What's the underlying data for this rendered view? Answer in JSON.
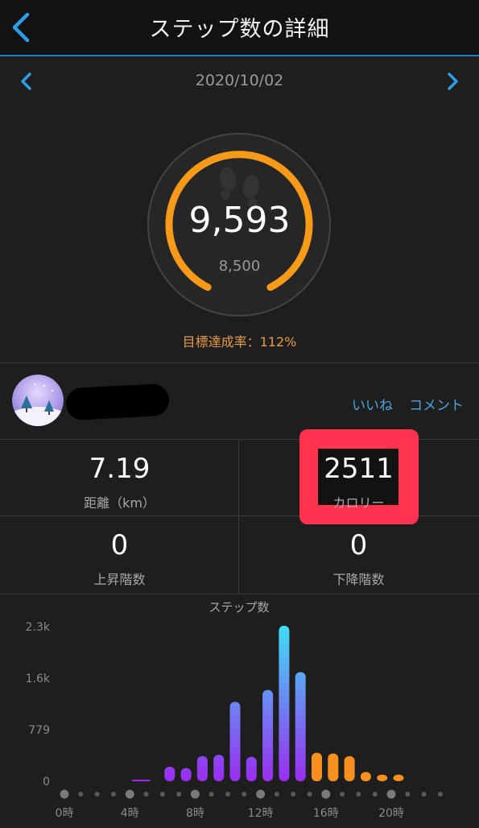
{
  "header": {
    "title": "ステップ数の詳細"
  },
  "date_nav": {
    "date": "2020/10/02"
  },
  "summary": {
    "steps": "9,593",
    "goal": "8,500",
    "achievement": "目標達成率：112%",
    "progress_fraction": 1.0
  },
  "social": {
    "like": "いいね",
    "comment": "コメント"
  },
  "stats": {
    "distance": {
      "value": "7.19",
      "label": "距離（km）"
    },
    "calories": {
      "value": "2511",
      "label": "カロリー"
    },
    "floors_up": {
      "value": "0",
      "label": "上昇階数"
    },
    "floors_down": {
      "value": "0",
      "label": "下降階数"
    }
  },
  "colors": {
    "ring": "#f79a1a",
    "accent_blue": "#2b9ee6",
    "link": "#4aa3df",
    "highlight": "#ff334f",
    "bar_low": "#9a2cf0",
    "bar_high": "#40dcf5",
    "bar_orange": "#f7901e"
  },
  "chart_data": {
    "type": "bar",
    "title": "ステップ数",
    "y_ticks": [
      "2.3k",
      "1.6k",
      "779",
      "0"
    ],
    "y_tick_values": [
      2337,
      1558,
      779,
      0
    ],
    "ylim": [
      0,
      2337
    ],
    "x_tick_labels": [
      "0時",
      "4時",
      "8時",
      "12時",
      "16時",
      "20時"
    ],
    "x_tick_hours": [
      0,
      4,
      8,
      12,
      16,
      20
    ],
    "hours": [
      4,
      4.5,
      6,
      6.5,
      7,
      7.5,
      8,
      8.5,
      9,
      9.5,
      10,
      10.5,
      11,
      11.5,
      12,
      12.5,
      13,
      13.5,
      14,
      14.5,
      15,
      15.5,
      16,
      16.5,
      17,
      17.5,
      18,
      18.5,
      19,
      19.5,
      20,
      20.5
    ],
    "values": [
      5,
      5,
      220,
      200,
      380,
      400,
      1200,
      370,
      1380,
      2350,
      1650,
      430,
      420,
      380,
      140,
      100,
      100
    ],
    "bar_hours": [
      4,
      4.5,
      6,
      7,
      8,
      9,
      10,
      11,
      12,
      13,
      14,
      15,
      16,
      17,
      18,
      19,
      20
    ],
    "bar_colors": [
      "purple",
      "purple",
      "gradient",
      "gradient",
      "gradient",
      "gradient",
      "gradient",
      "gradient",
      "gradient",
      "gradient",
      "gradient",
      "orange",
      "orange",
      "orange",
      "orange",
      "orange",
      "orange"
    ]
  }
}
